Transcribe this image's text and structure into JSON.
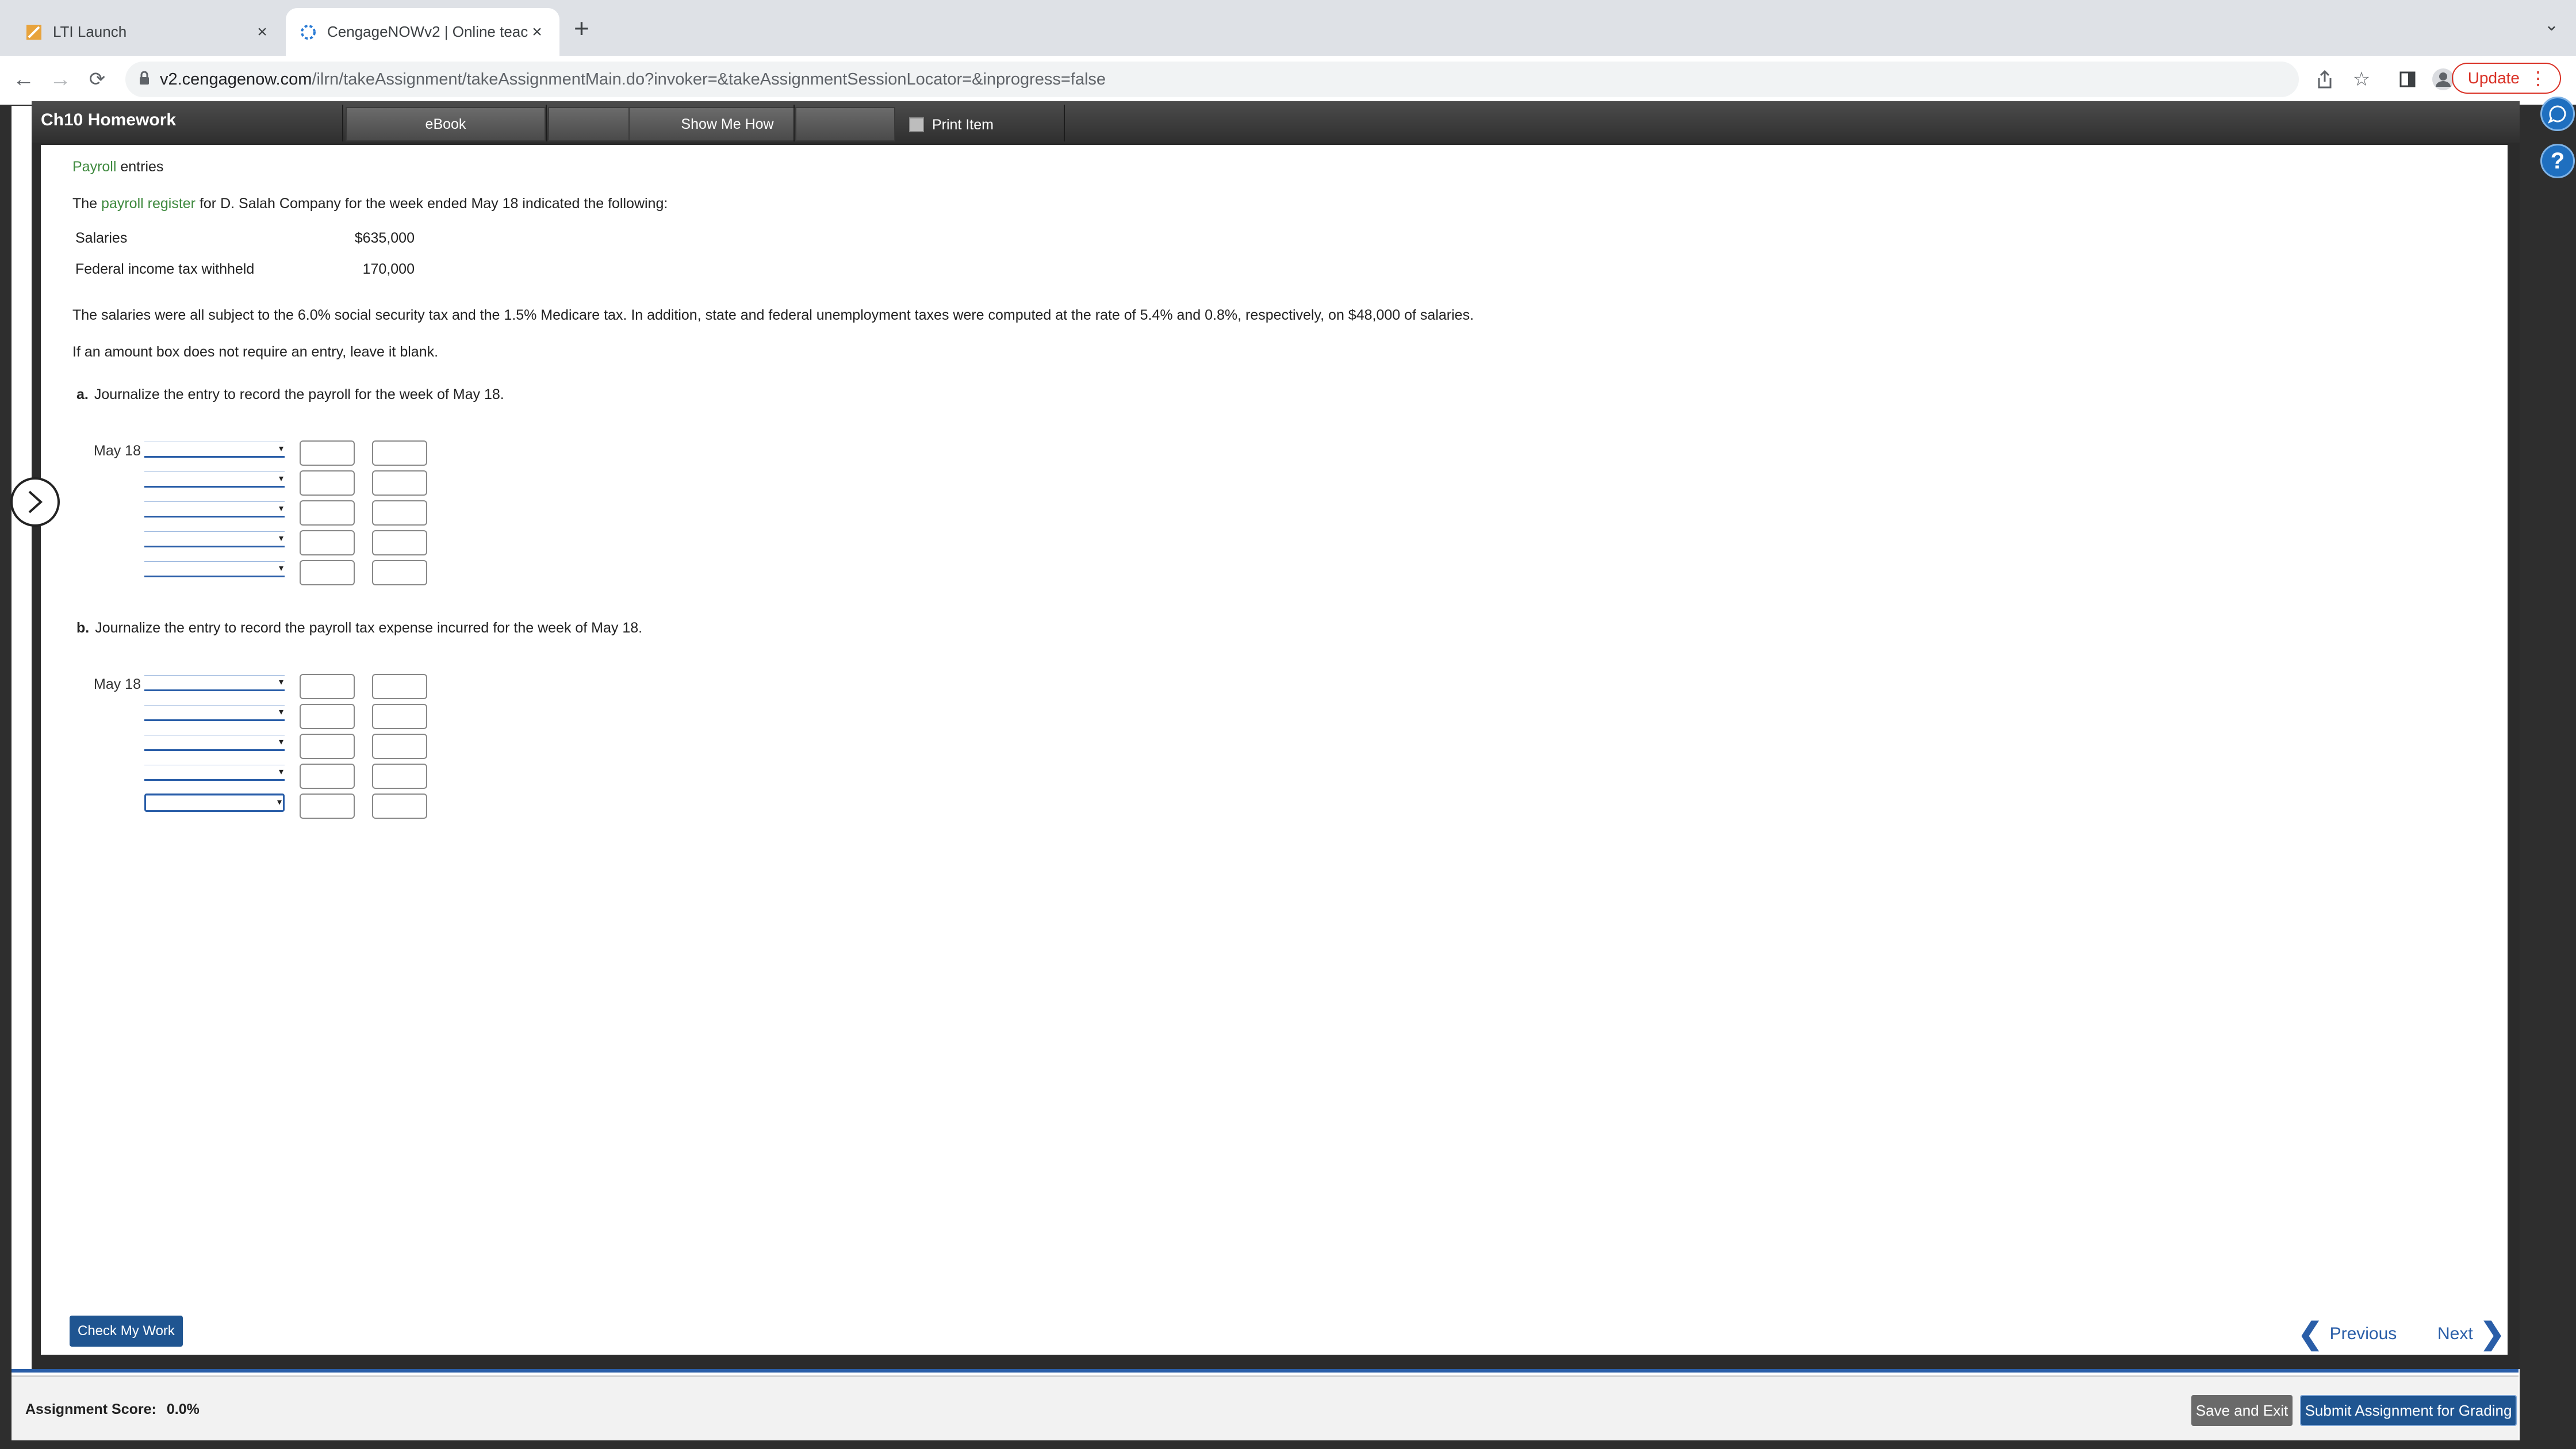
{
  "browser": {
    "tabs": [
      {
        "title": "LTI Launch",
        "active": false
      },
      {
        "title": "CengageNOWv2 | Online teach",
        "active": true
      }
    ],
    "url_domain": "v2.cengagenow.com",
    "url_path": "/ilrn/takeAssignment/takeAssignmentMain.do?invoker=&takeAssignmentSessionLocator=&inprogress=false",
    "update_label": "Update"
  },
  "header": {
    "title": "Ch10 Homework",
    "ebook_label": "eBook",
    "show_me_how_label": "Show Me How",
    "print_item_label": "Print Item"
  },
  "problem": {
    "topic_link": "Payroll",
    "topic_rest": "entries",
    "intro_pre": "The",
    "intro_link": "payroll register",
    "intro_post": "for D. Salah Company for the week ended May 18 indicated the following:",
    "register": [
      {
        "label": "Salaries",
        "amount": "$635,000"
      },
      {
        "label": "Federal income tax withheld",
        "amount": "170,000"
      }
    ],
    "details": "The salaries were all subject to the 6.0% social security tax and the 1.5% Medicare tax. In addition, state and federal unemployment taxes were computed at the rate of 5.4% and 0.8%, respectively, on $48,000 of salaries.",
    "instruction": "If an amount box does not require an entry, leave it blank.",
    "part_a": {
      "letter": "a.",
      "text": "Journalize the entry to record the payroll for the week of May 18.",
      "date": "May 18"
    },
    "part_b": {
      "letter": "b.",
      "text": "Journalize the entry to record the payroll tax expense incurred for the week of May 18.",
      "date": "May 18"
    }
  },
  "nav": {
    "check_label": "Check My Work",
    "previous_label": "Previous",
    "next_label": "Next"
  },
  "footer": {
    "score_label": "Assignment Score:",
    "score_value": "0.0%",
    "save_exit_label": "Save and Exit",
    "submit_label": "Submit Assignment for Grading"
  },
  "colors": {
    "link_green": "#3f8a3f",
    "accent_blue": "#2a5ea8",
    "button_navy": "#1f5591"
  }
}
